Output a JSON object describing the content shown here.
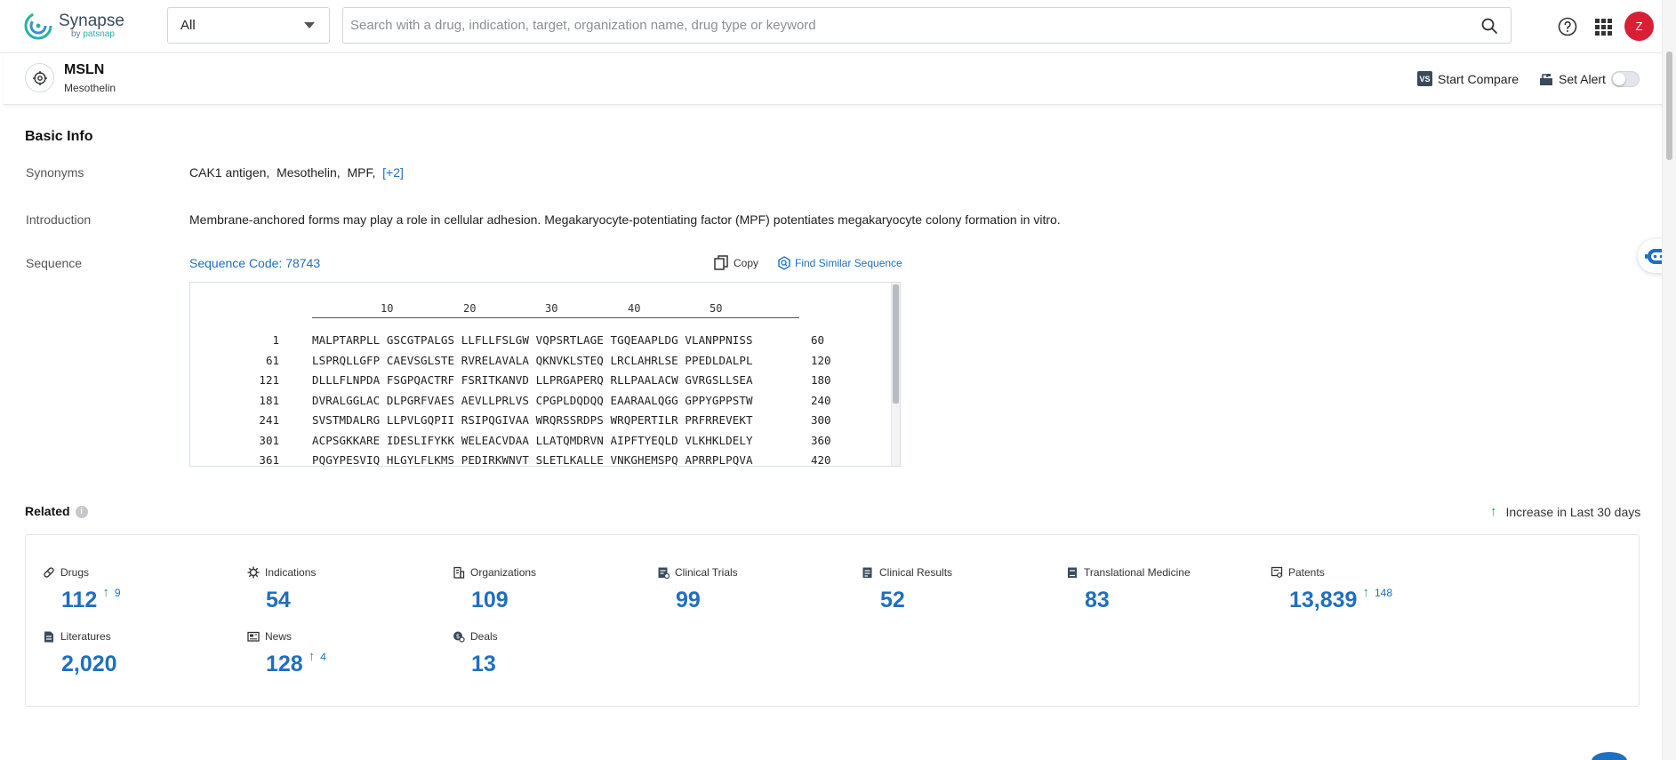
{
  "header": {
    "logo_title": "Synapse",
    "logo_sub_prefix": "by",
    "logo_sub_brand": "patsnap",
    "scope_value": "All",
    "search_placeholder": "Search with a drug, indication, target, organization name, drug type or keyword",
    "avatar_initial": "Z"
  },
  "target": {
    "name": "MSLN",
    "full_name": "Mesothelin",
    "compare_badge": "VS",
    "compare_label": "Start Compare",
    "alert_label": "Set Alert"
  },
  "basic_info": {
    "title": "Basic Info",
    "synonyms_label": "Synonyms",
    "synonyms": [
      "CAK1 antigen,",
      "Mesothelin,",
      "MPF,"
    ],
    "synonyms_more": "[+2]",
    "introduction_label": "Introduction",
    "introduction": "Membrane-anchored forms may play a role in cellular adhesion. Megakaryocyte-potentiating factor (MPF) potentiates megakaryocyte colony formation in vitro.",
    "sequence_label": "Sequence",
    "sequence_code": "Sequence Code: 78743",
    "copy_label": "Copy",
    "similar_label": "Find Similar Sequence",
    "ruler": [
      "10",
      "20",
      "30",
      "40",
      "50"
    ],
    "sequence_lines": [
      {
        "start": "1",
        "residues": "MALPTARPLL GSCGTPALGS LLFLLFSLGW VQPSRTLAGE TGQEAAPLDG VLANPPNISS",
        "end": "60"
      },
      {
        "start": "61",
        "residues": "LSPRQLLGFP CAEVSGLSTE RVRELAVALA QKNVKLSTEQ LRCLAHRLSE PPEDLDALPL",
        "end": "120"
      },
      {
        "start": "121",
        "residues": "DLLLFLNPDA FSGPQACTRF FSRITKANVD LLPRGAPERQ RLLPAALACW GVRGSLLSEA",
        "end": "180"
      },
      {
        "start": "181",
        "residues": "DVRALGGLAC DLPGRFVAES AEVLLPRLVS CPGPLDQDQQ EAARAALQGG GPPYGPPSTW",
        "end": "240"
      },
      {
        "start": "241",
        "residues": "SVSTMDALRG LLPVLGQPII RSIPQGIVAA WRQRSSRDPS WRQPERTILR PRFRREVEKT",
        "end": "300"
      },
      {
        "start": "301",
        "residues": "ACPSGKKARE IDESLIFYKK WELEACVDAA LLATQMDRVN AIPFTYEQLD VLKHKLDELY",
        "end": "360"
      },
      {
        "start": "361",
        "residues": "PQGYPESVIQ HLGYLFLKMS PEDIRKWNVT SLETLKALLE VNKGHEMSPQ APRRPLPQVA",
        "end": "420"
      }
    ]
  },
  "related": {
    "title": "Related",
    "info_glyph": "i",
    "legend_label": "Increase in Last 30 days",
    "stats": [
      {
        "label": "Drugs",
        "value": "112",
        "increase": "9",
        "icon": "pill-icon"
      },
      {
        "label": "Indications",
        "value": "54",
        "increase": null,
        "icon": "virus-icon"
      },
      {
        "label": "Organizations",
        "value": "109",
        "increase": null,
        "icon": "building-icon"
      },
      {
        "label": "Clinical Trials",
        "value": "99",
        "increase": null,
        "icon": "clipboard-icon"
      },
      {
        "label": "Clinical Results",
        "value": "52",
        "increase": null,
        "icon": "report-icon"
      },
      {
        "label": "Translational Medicine",
        "value": "83",
        "increase": null,
        "icon": "book-icon"
      },
      {
        "label": "Patents",
        "value": "13,839",
        "increase": "148",
        "icon": "patent-icon"
      },
      {
        "label": "Literatures",
        "value": "2,020",
        "increase": null,
        "icon": "document-icon"
      },
      {
        "label": "News",
        "value": "128",
        "increase": "4",
        "icon": "newspaper-icon"
      },
      {
        "label": "Deals",
        "value": "13",
        "increase": null,
        "icon": "deal-icon"
      }
    ]
  },
  "colors": {
    "accent": "#1f6fbf",
    "increase": "#2e9e3e",
    "avatar": "#d81f33"
  }
}
